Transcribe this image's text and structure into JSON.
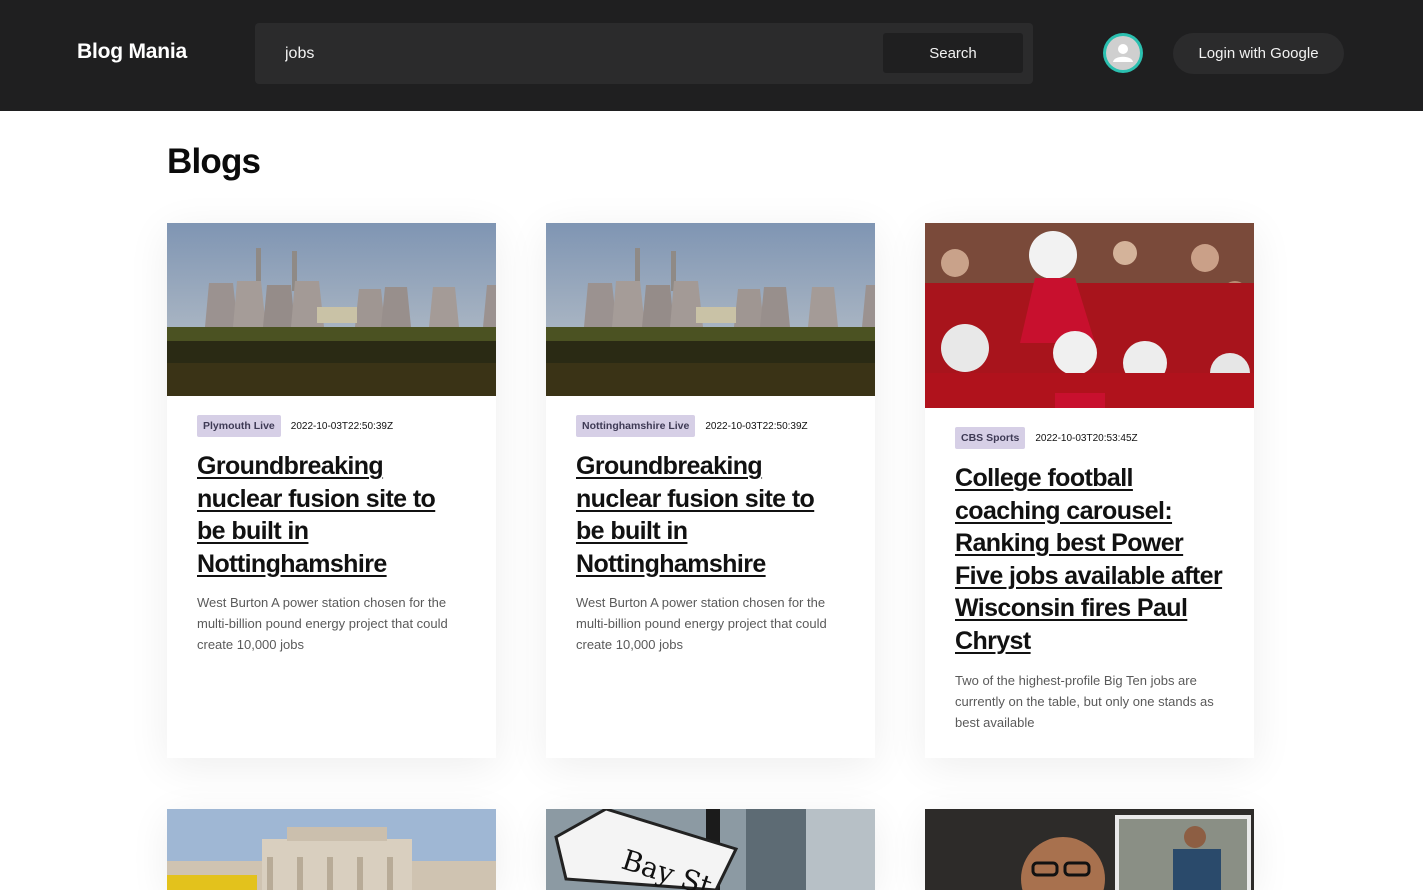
{
  "header": {
    "brand": "Blog Mania",
    "search_value": "jobs",
    "search_button": "Search",
    "login_button": "Login with Google"
  },
  "page_title": "Blogs",
  "cards": [
    {
      "source": "Plymouth Live",
      "date": "2022-10-03T22:50:39Z",
      "title": "Groundbreaking nuclear fusion site to be built in Nottinghamshire",
      "description": "West Burton A power station chosen for the multi-billion pound energy project that could create 10,000 jobs",
      "image": "power-station-image"
    },
    {
      "source": "Nottinghamshire Live",
      "date": "2022-10-03T22:50:39Z",
      "title": "Groundbreaking nuclear fusion site to be built in Nottinghamshire",
      "description": "West Burton A power station chosen for the multi-billion pound energy project that could create 10,000 jobs",
      "image": "power-station-image"
    },
    {
      "source": "CBS Sports",
      "date": "2022-10-03T20:53:45Z",
      "title": "College football coaching carousel: Ranking best Power Five jobs available after Wisconsin fires Paul Chryst",
      "description": "Two of the highest-profile Big Ten jobs are currently on the table, but only one stands as best available",
      "image": "football-players-image"
    },
    {
      "image": "government-building-image"
    },
    {
      "image": "bay-st-sign-image",
      "sign_text": "Bay St"
    },
    {
      "image": "portrait-photo-image"
    }
  ]
}
